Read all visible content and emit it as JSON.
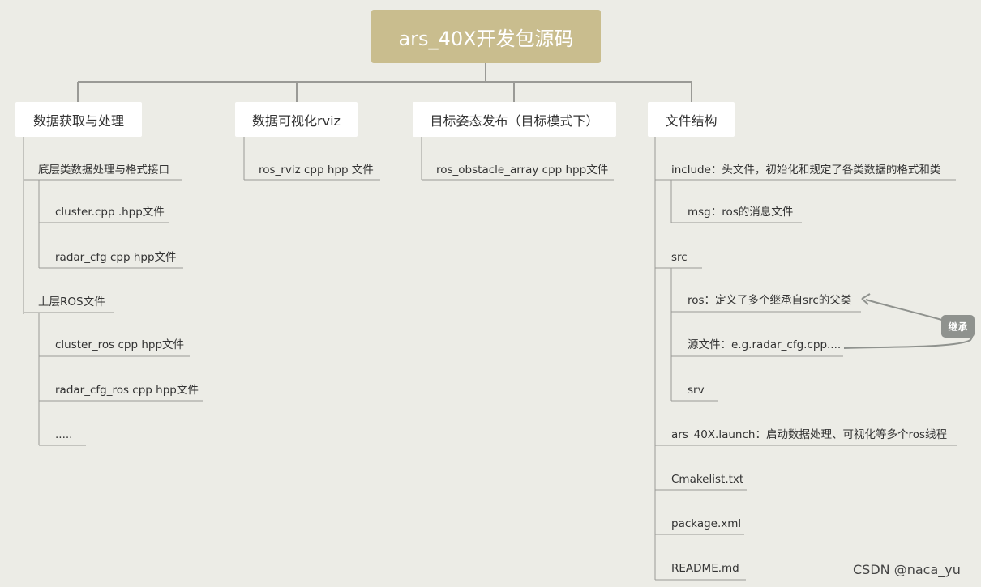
{
  "root": {
    "title": "ars_40X开发包源码"
  },
  "branches": [
    {
      "label": "数据获取与处理",
      "children": [
        {
          "label": "底层类数据处理与格式接口",
          "children": [
            "cluster.cpp .hpp文件",
            "radar_cfg cpp hpp文件"
          ]
        },
        {
          "label": "上层ROS文件",
          "children": [
            "cluster_ros cpp hpp文件",
            "radar_cfg_ros cpp hpp文件",
            "....."
          ]
        }
      ]
    },
    {
      "label": "数据可视化rviz",
      "children": [
        "ros_rviz cpp hpp 文件"
      ]
    },
    {
      "label": "目标姿态发布（目标模式下）",
      "children": [
        "ros_obstacle_array cpp hpp文件"
      ]
    },
    {
      "label": "文件结构",
      "children": [
        {
          "label": "include：头文件，初始化和规定了各类数据的格式和类",
          "children": [
            "msg：ros的消息文件"
          ]
        },
        {
          "label": "src",
          "children": [
            "ros：定义了多个继承自src的父类",
            "源文件：e.g.radar_cfg.cpp....",
            "srv"
          ]
        },
        {
          "label": "ars_40X.launch：启动数据处理、可视化等多个ros线程"
        },
        {
          "label": "Cmakelist.txt"
        },
        {
          "label": "package.xml"
        },
        {
          "label": "README.md"
        }
      ]
    }
  ],
  "callout": {
    "label": "继承"
  },
  "watermark": "CSDN @naca_yu",
  "colors": {
    "background": "#ecece6",
    "root": "#c9bd8e",
    "branch": "#ffffff",
    "line": "#9a9a96",
    "callout": "#8f928e"
  }
}
